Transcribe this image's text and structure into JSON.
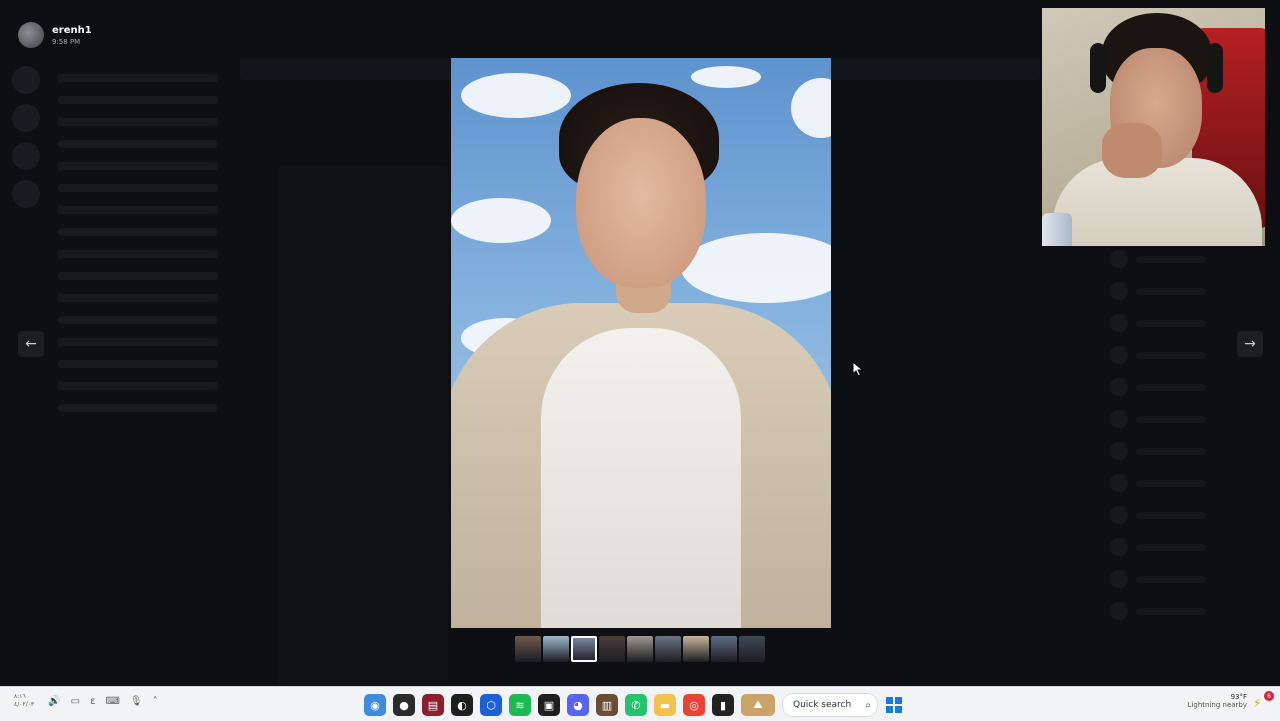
{
  "viewer": {
    "user_name": "erenh1",
    "timestamp": "9:58 PM"
  },
  "nav": {
    "prev_arrow": "←",
    "next_arrow": "→"
  },
  "thumbnails": {
    "count": 9,
    "active_index": 2
  },
  "taskbar": {
    "clock_line1": "٨:١٦",
    "clock_line2": "٤/٠٢/٠٣",
    "search_label": "Quick search",
    "weather_temp": "93°F",
    "weather_condition": "Lightning nearby",
    "notification_count": "6"
  },
  "colors": {
    "taskbar_bg": "#f1f3f7",
    "windows_blue": "#1a7ad9",
    "spotify_green": "#1db954",
    "discord_blurple": "#5865f2",
    "alert_red": "#d8233a"
  }
}
